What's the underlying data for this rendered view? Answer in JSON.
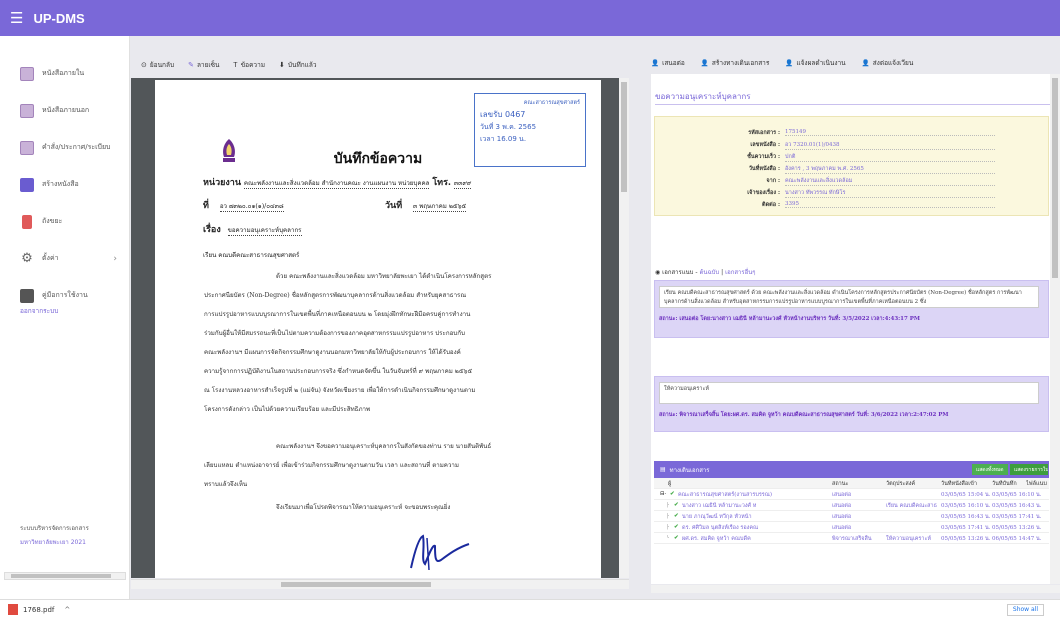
{
  "app": {
    "title": "UP-DMS"
  },
  "sidebar": {
    "items": [
      {
        "label": "หนังสือภายใน",
        "icon": "inbox-document-icon"
      },
      {
        "label": "หนังสือภายนอก",
        "icon": "outside-document-icon"
      },
      {
        "label": "คำสั่ง/ประกาศ/ระเบียบ",
        "icon": "order-document-icon"
      },
      {
        "label": "สร้างหนังสือ",
        "icon": "create-document-icon"
      },
      {
        "label": "ถังขยะ",
        "icon": "trash-icon"
      },
      {
        "label": "ตั้งค่า",
        "icon": "gear-icon"
      },
      {
        "label": "คู่มือการใช้งาน",
        "icon": "manual-icon"
      }
    ],
    "logout": "ออกจากระบบ",
    "footer_line1": "ระบบบริหารจัดการเอกสาร",
    "footer_line2": "มหาวิทยาลัยพะเยา 2021"
  },
  "pdf_toolbar": {
    "back": "ย้อนกลับ",
    "sign": "ลายเซ็น",
    "text": "ข้อความ",
    "saved": "บันทึกแล้ว"
  },
  "pdf": {
    "stamp": {
      "org": "คณะสาธารณสุขศาสตร์",
      "number": "เลขรับ 0467",
      "date": "วันที่ 3 พ.ค. 2565",
      "time": "เวลา 16.09 น."
    },
    "title": "บันทึกข้อความ",
    "agency_label": "หน่วยงาน",
    "agency_value": "คณะพลังงานและสิ่งแวดล้อม สำนักงานคณะ งานแผนงาน หน่วยบุคคล",
    "tel_label": "โทร.",
    "tel_value": "๓๓๙๙",
    "ref_label": "ที่",
    "ref_value": "อว ๗๓๒๐.๐๑(๑)/๐๔๓๘",
    "date_label": "วันที่",
    "date_value": "๓ พฤษภาคม ๒๕๖๕",
    "subject_label": "เรื่อง",
    "subject_value": "ขอความอนุเคราะห์บุคลากร",
    "salutation": "เรียน คณบดีคณะสาธารณสุขศาสตร์",
    "paragraph1": [
      "ด้วย คณะพลังงานและสิ่งแวดล้อม มหาวิทยาลัยพะเยา ได้ดำเนินโครงการหลักสูตร",
      "ประกาศนียบัตร (Non-Degree) ชื่อหลักสูตรการพัฒนาบุคลากรด้านสิ่งแวดล้อม สำหรับยุคสาธารณ",
      "การแปรรูปอาหารแบบบูรณาการในเขตพื้นที่ภาคเหนือตอนบน ๒ โดยมุ่งฝึกทักษะฝีมือครบคู่การทำงาน",
      "ร่วมกับผู้อื่นให้มีสมรรถนะที่เป็นไปตามความต้องการของภาคอุตสาหกรรมแปรรูปอาหาร ประกอบกับ",
      "คณะพลังงานฯ มีแผนการจัดกิจกรรมศึกษาดูงานนอกมหาวิทยาลัยให้กับผู้ประกอบการ ให้ได้รับองค์",
      "ความรู้จากการปฏิบัติงานในสถานประกอบการจริง ซึ่งกำหนดจัดขึ้น ในวันจันทร์ที่ ๙ พฤษภาคม ๒๕๖๕",
      "ณ โรงงานหลวงอาหารสำเร็จรูปที่ ๒ (แม่จัน) จังหวัดเชียงราย เพื่อให้การดำเนินกิจกรรมศึกษาดูงานตาม",
      "โครงการดังกล่าว เป็นไปด้วยความเรียบร้อย และมีประสิทธิภาพ"
    ],
    "paragraph2": [
      "คณะพลังงานฯ จึงขอความอนุเคราะห์บุคลากรในสังกัดของท่าน ราย นายสันติพันธ์",
      "เลียบแหลม ตำแหน่งอาจารย์ เพื่อเข้าร่วมกิจกรรมศึกษาดูงานตามวัน เวลา และสถานที่ ตามความ",
      "ทราบแล้วจึงเห็น"
    ],
    "closing": "จึงเรียนมาเพื่อโปรดพิจารณาให้ความอนุเคราะห์ จะขอบพระคุณยิ่ง"
  },
  "right_links": [
    "เสนอต่อ",
    "สร้างทางเดินเอกสาร",
    "แจ้งผลดำเนินงาน",
    "ส่งต่อแจ้งเวียน"
  ],
  "right_panel": {
    "title": "ขอความอนุเคราะห์บุคลากร",
    "info": [
      {
        "label": "รหัสเอกสาร :",
        "value": "175149"
      },
      {
        "label": "เลขหนังสือ :",
        "value": "อว 7320.01(1)/0438"
      },
      {
        "label": "ชั้นความเร็ว :",
        "value": "ปกติ"
      },
      {
        "label": "วันที่หนังสือ :",
        "value": "อังคาร , 3 พฤษภาคม พ.ศ. 2565"
      },
      {
        "label": "จาก :",
        "value": "คณะพลังงานและสิ่งแวดล้อม"
      },
      {
        "label": "เจ้าของเรื่อง :",
        "value": "นางสาว ทัพวรรณ ทักษิโร"
      },
      {
        "label": "ติดต่อ :",
        "value": "3395"
      }
    ],
    "attachments_label": "เอกสารแนบ -",
    "attachments_link1": "ต้นฉบับ",
    "attachments_sep": "|",
    "attachments_link2": "เอกสารอื่นๆ",
    "note1": {
      "text": "เรียน คณบดีคณะสาธารณสุขศาสตร์ ด้วย คณะพลังงานและสิ่งแวดล้อม ดำเนินโครงการหลักสูตรประกาศนียบัตร (Non-Degree) ชื่อหลักสูตร การพัฒนาบุคลากรด้านสิ่งแวดล้อม สำหรับอุตสาหกรรมการแปรรูปอาหารแบบบูรณาการในเขตพื้นที่ภาคเหนือตอนบน 2 ซึ่ง",
      "status": "สถานะ: เสนอต่อ",
      "by": "โดย:นางสาว เฌธินี หล้ามานะวงศ์ หัวหน้างานบริหาร",
      "date": "วันที่: 3/5/2022",
      "time": "เวลา:4:43:17 PM"
    },
    "note2": {
      "text": "ให้ความอนุเคราะห์",
      "status": "สถานะ: พิจารณาเสร็จสิ้น",
      "by": "โดย:ผศ.ดร. สมคิด จูหว้า คณบดีคณะสาธารณสุขศาสตร์",
      "date": "วันที่: 3/6/2022",
      "time": "เวลา:2:47:02 PM"
    },
    "route": {
      "title": "ทางเดินเอกสาร",
      "btn1": "แสดงทั้งหมด",
      "btn2": "แสดงรายการในหน่วยงาน",
      "headers": [
        "ผู้",
        "สถานะ",
        "วัตถุประสงค์",
        "วันที่หนังสือเข้า",
        "วันที่บันทึก",
        "ไฟล์แนบ"
      ],
      "rows": [
        {
          "who": "คณะสาธารณสุขศาสตร์(งานสารบรรณ)",
          "status": "เสนอต่อ",
          "purpose": "",
          "in": "03/05/65 15:04 น.",
          "saved": "03/05/65 16:10 น.",
          "tree": "⊟-",
          "check": "✔"
        },
        {
          "who": "นางสาว เฌธินี หล้ามานะวงศ์ ห",
          "status": "เสนอต่อ",
          "purpose": "เรียน คณบดีคณะสาธ",
          "in": "03/05/65 16:10 น.",
          "saved": "03/05/65 16:43 น.",
          "tree": "├",
          "check": "✔"
        },
        {
          "who": "นาย ภาณุวัฒน์ ทวีกุล หัวหน้า",
          "status": "เสนอต่อ",
          "purpose": "",
          "in": "03/05/65 16:43 น.",
          "saved": "03/05/65 17:41 น.",
          "tree": "├",
          "check": "✔"
        },
        {
          "who": "ดร. ศศิวิมล นุตสิงห์เรือง รองคณ",
          "status": "เสนอต่อ",
          "purpose": "",
          "in": "03/05/65 17:41 น.",
          "saved": "05/05/65 13:26 น.",
          "tree": "├",
          "check": "✔"
        },
        {
          "who": "ผศ.ดร. สมคิด จูหว้า คณบดีค",
          "status": "พิจารณาเสร็จสิ้น",
          "purpose": "ให้ความอนุเคราะห์",
          "in": "05/05/65 13:26 น.",
          "saved": "06/05/65 14:47 น.",
          "tree": "└",
          "check": "✔"
        }
      ]
    }
  },
  "download": {
    "filename": "1768.pdf",
    "show_all": "Show all"
  },
  "colors": {
    "brand": "#7a68d8",
    "info_bg": "#fbf8de",
    "note_bg": "#dcd5f6"
  }
}
